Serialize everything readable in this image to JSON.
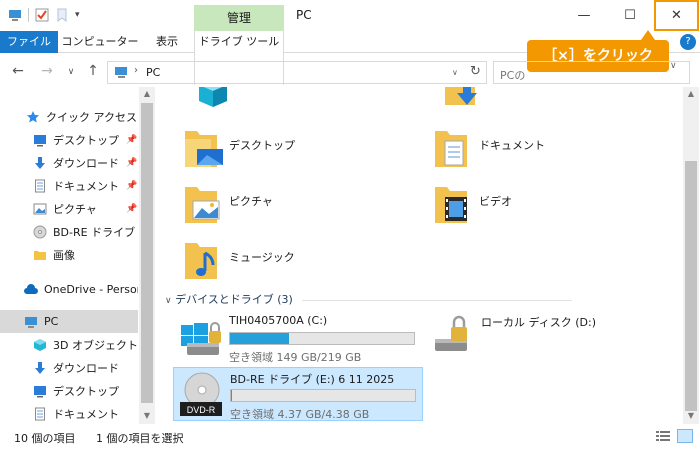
{
  "window": {
    "title": "PC",
    "context_tab_title": "管理",
    "minimize_glyph": "—",
    "maximize_glyph": "☐",
    "close_glyph": "✕"
  },
  "ribbon": {
    "tabs": [
      "ファイル",
      "コンピューター",
      "表示",
      "ドライブ ツール"
    ]
  },
  "callout": {
    "text": "［×］をクリック",
    "color": "#f39800"
  },
  "address": {
    "path": "PC",
    "search_placeholder": "PCの"
  },
  "sidebar": {
    "items": [
      {
        "label": "クイック アクセス",
        "icon": "star-icon",
        "pinned": false
      },
      {
        "label": "デスクトップ",
        "icon": "desktop-icon",
        "pinned": true
      },
      {
        "label": "ダウンロード",
        "icon": "download-icon",
        "pinned": true
      },
      {
        "label": "ドキュメント",
        "icon": "document-icon",
        "pinned": true
      },
      {
        "label": "ピクチャ",
        "icon": "picture-icon",
        "pinned": true
      },
      {
        "label": "BD-RE ドライブ (E:",
        "icon": "disc-icon",
        "pinned": false
      },
      {
        "label": "画像",
        "icon": "folder-icon",
        "pinned": false
      },
      {
        "label": "OneDrive - Person",
        "icon": "cloud-icon",
        "pinned": false
      },
      {
        "label": "PC",
        "icon": "pc-icon",
        "pinned": false,
        "selected": true
      },
      {
        "label": "3D オブジェクト",
        "icon": "cube-icon",
        "pinned": false
      },
      {
        "label": "ダウンロード",
        "icon": "download-icon",
        "pinned": false
      },
      {
        "label": "デスクトップ",
        "icon": "desktop-icon",
        "pinned": false
      },
      {
        "label": "ドキュメント",
        "icon": "document-icon",
        "pinned": false
      }
    ],
    "pin_glyph": "📌"
  },
  "folders": [
    {
      "label": "",
      "icon": "3d-objects-folder-icon"
    },
    {
      "label": "",
      "icon": "downloads-folder-icon"
    },
    {
      "label": "デスクトップ",
      "icon": "desktop-folder-icon"
    },
    {
      "label": "ドキュメント",
      "icon": "documents-folder-icon"
    },
    {
      "label": "ピクチャ",
      "icon": "pictures-folder-icon"
    },
    {
      "label": "ビデオ",
      "icon": "videos-folder-icon"
    },
    {
      "label": "ミュージック",
      "icon": "music-folder-icon"
    }
  ],
  "drives_group": {
    "label": "デバイスとドライブ (3)"
  },
  "drives": [
    {
      "name": "TIH0405700A (C:)",
      "free": "空き領域 149 GB/219 GB",
      "used_fraction": 0.32,
      "icon": "windows-drive-icon",
      "selected": false
    },
    {
      "name": "ローカル ディスク (D:)",
      "free": "",
      "used_fraction": null,
      "icon": "locked-drive-icon",
      "selected": false
    },
    {
      "name": "BD-RE ドライブ (E:) 6 11 2025",
      "free": "空き領域 4.37 GB/4.38 GB",
      "used_fraction": 0.002,
      "icon": "dvd-r-icon",
      "badge": "DVD-R",
      "selected": true
    }
  ],
  "status": {
    "count": "10 個の項目",
    "selection": "1 個の項目を選択"
  },
  "colors": {
    "accent": "#1979ca",
    "callout": "#f39800",
    "context_tab": "#c8e7bd",
    "selection": "#cce8ff",
    "bar_fill": "#26a0da"
  }
}
